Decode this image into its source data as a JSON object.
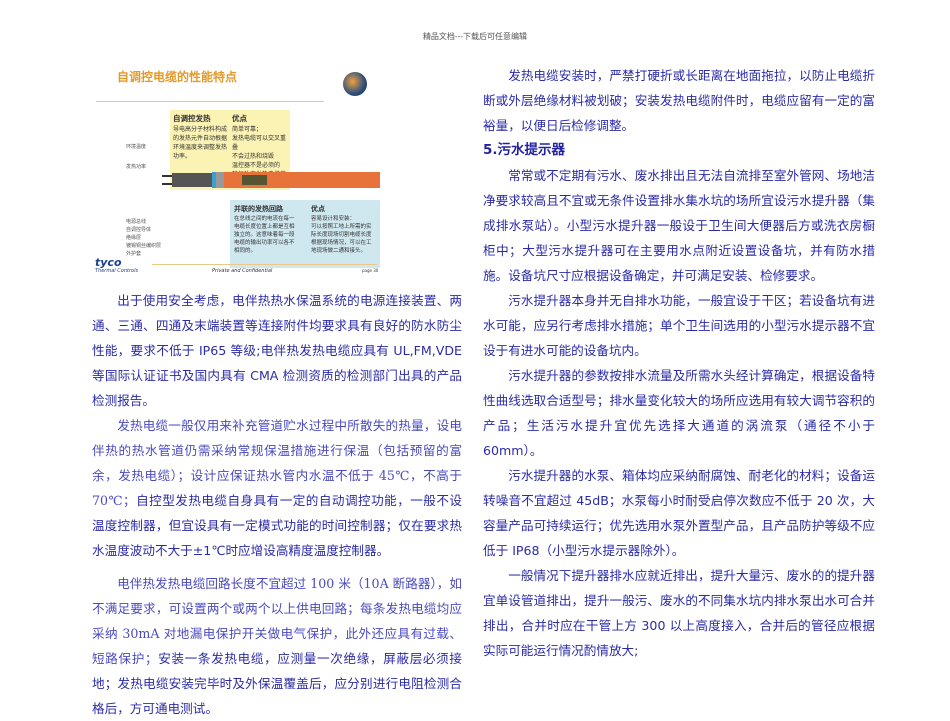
{
  "header": "精品文档---下载后可任意编辑",
  "figure": {
    "title": "自调控电缆的性能特点",
    "box_yellow": {
      "heading": "自调控发热",
      "text": "导电高分子材料构成的发热元件自动根据环境温度来调整发热功率。",
      "adv_heading": "优点",
      "adv": [
        "简单可靠；",
        "发热电缆可以交叉重叠",
        "不会过热和烧毁",
        "温控器不是必须的",
        "较恒功率发热电缆节省能耗"
      ]
    },
    "box_blue": {
      "heading": "并联的发热回路",
      "text": "在总线之间的电流在每一电缆长度位置上都是互相独立的。这意味着每一段电缆的输出功率可以各不相同的。",
      "adv_heading": "优点",
      "adv_intro": "容易设计和安装：",
      "adv": [
        "可以按照工地上所需的实际长度现场切割电缆长度",
        "根据现场情况，可以在工地现场做二通和接头。"
      ]
    },
    "labels_top": [
      "环境温度",
      "发热功率"
    ],
    "labels_bottom": [
      "电源总线",
      "自调控导体",
      "绝缘层",
      "镀锡铜丝编织层",
      "外护套"
    ],
    "logo": "tyco",
    "logo_sub": "Thermal Controls",
    "footer": "Private and Confidential",
    "page": "page 30"
  },
  "left": {
    "p1": "出于使用安全考虑，电伴热热水保温系统的电源连接装置、两通、三通、四通及末端装置等连接附件均要求具有良好的防水防尘性能，要求不低于 IP65 等级;电伴热发热电缆应具有 UL,FM,VDE 等国际认证证书及国内具有 CMA 检测资质的检测部门出具的产品检测报告。",
    "p2_serif": "发热电缆一般仅用来补充管道贮水过程中所散失的热量，设电伴热的热水管道仍需采纳常规保温措施进行保温（包括预留的富余，发热电缆）；设计应保证热水管内水温不低于 45℃，不高于 70℃；",
    "p2_sans": "自控型发热电缆自身具有一定的自动调控功能，一般不设温度控制器，但宜设具有一定模式功能的时间控制器；仅在要求热水温度波动不大于±1℃时应增设高精度温度控制器。",
    "p3_serif": "电伴热发热电缆回路长度不宜超过 100 米（10A 断路器），如不满足要求，可设置两个或两个以上供电回路；每条发热电缆均应采纳 30mA 对地漏电保护开关做电气保护，此外还应具有过载、短路保护；",
    "p3_sans": "安装一条发热电缆，应测量一次绝缘，屏蔽层必须接地；发热电缆安装完毕时及外保温覆盖后，应分别进行电阻检测合格后，方可通电测试。"
  },
  "right": {
    "p1": "发热电缆安装时，严禁打硬折或长距离在地面拖拉，以防止电缆折断或外层绝缘材料被划破；安装发热电缆附件时，电缆应留有一定的富裕量，以便日后检修调整。",
    "heading": "5.污水提示器",
    "p2": "常常或不定期有污水、废水排出且无法自流排至室外管网、场地洁净要求较高且不宜或无条件设置排水集水坑的场所宜设污水提升器（集成排水泵站）。小型污水提升器一般设于卫生间大便器后方或洗衣房橱柜中；大型污水提升器可在主要用水点附近设置设备坑，并有防水措施。设备坑尺寸应根据设备确定，并可满足安装、检修要求。",
    "p3": "污水提升器本身并无自排水功能，一般宜设于干区；若设备坑有进水可能，应另行考虑排水措施；单个卫生间选用的小型污水提示器不宜设于有进水可能的设备坑内。",
    "p4": "污水提升器的参数按排水流量及所需水头经计算确定，根据设备特性曲线选取合适型号；排水量变化较大的场所应选用有较大调节容积的产品；生活污水提升宜优先选择大通道的涡流泵（通径不小于 60mm）。",
    "p5": "污水提升器的水泵、箱体均应采纳耐腐蚀、耐老化的材料；设备运转噪音不宜超过 45dB；水泵每小时耐受启停次数应不低于 20 次，大容量产品可持续运行；优先选用水泵外置型产品，且产品防护等级不应低于 IP68（小型污水提示器除外）。",
    "p6": "一般情况下提升器排水应就近排出，提升大量污、废水的的提升器宜单设管道排出，提升一般污、废水的不同集水坑内排水泵出水可合并排出，合并时应在干管上方 300 以上高度接入，合并后的管径应根据实际可能运行情况酌情放大;"
  }
}
